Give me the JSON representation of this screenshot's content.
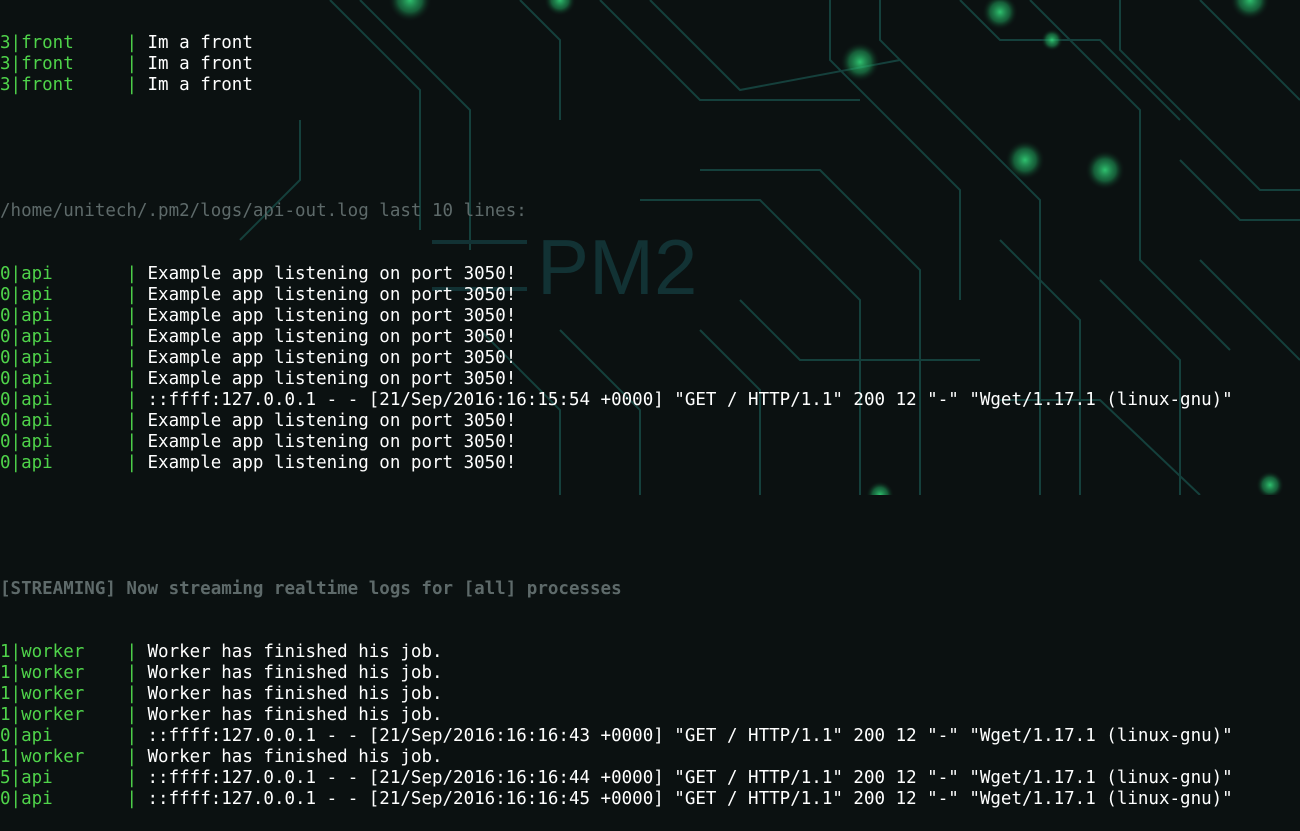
{
  "watermark": {
    "logo_text": "PM2"
  },
  "colors": {
    "background": "#0b1111",
    "prefix": "#4fd34a",
    "message": "#ffffff",
    "header": "#5e6a6a",
    "circuit_line": "#15403c",
    "circuit_node": "#2fd27a"
  },
  "log": {
    "top_lines": [
      {
        "prefix": "3|front",
        "message": "Im a front"
      },
      {
        "prefix": "3|front",
        "message": "Im a front"
      },
      {
        "prefix": "3|front",
        "message": "Im a front"
      }
    ],
    "api_header": "/home/unitech/.pm2/logs/api-out.log last 10 lines:",
    "api_lines": [
      {
        "prefix": "0|api",
        "message": "Example app listening on port 3050!"
      },
      {
        "prefix": "0|api",
        "message": "Example app listening on port 3050!"
      },
      {
        "prefix": "0|api",
        "message": "Example app listening on port 3050!"
      },
      {
        "prefix": "0|api",
        "message": "Example app listening on port 3050!"
      },
      {
        "prefix": "0|api",
        "message": "Example app listening on port 3050!"
      },
      {
        "prefix": "0|api",
        "message": "Example app listening on port 3050!"
      },
      {
        "prefix": "0|api",
        "message": "::ffff:127.0.0.1 - - [21/Sep/2016:16:15:54 +0000] \"GET / HTTP/1.1\" 200 12 \"-\" \"Wget/1.17.1 (linux-gnu)\""
      },
      {
        "prefix": "0|api",
        "message": "Example app listening on port 3050!"
      },
      {
        "prefix": "0|api",
        "message": "Example app listening on port 3050!"
      },
      {
        "prefix": "0|api",
        "message": "Example app listening on port 3050!"
      }
    ],
    "streaming_header": "[STREAMING] Now streaming realtime logs for [all] processes",
    "stream_lines": [
      {
        "prefix": "1|worker",
        "message": "Worker has finished his job."
      },
      {
        "prefix": "1|worker",
        "message": "Worker has finished his job."
      },
      {
        "prefix": "1|worker",
        "message": "Worker has finished his job."
      },
      {
        "prefix": "1|worker",
        "message": "Worker has finished his job."
      },
      {
        "prefix": "0|api",
        "message": "::ffff:127.0.0.1 - - [21/Sep/2016:16:16:43 +0000] \"GET / HTTP/1.1\" 200 12 \"-\" \"Wget/1.17.1 (linux-gnu)\""
      },
      {
        "prefix": "1|worker",
        "message": "Worker has finished his job."
      },
      {
        "prefix": "5|api",
        "message": "::ffff:127.0.0.1 - - [21/Sep/2016:16:16:44 +0000] \"GET / HTTP/1.1\" 200 12 \"-\" \"Wget/1.17.1 (linux-gnu)\""
      },
      {
        "prefix": "0|api",
        "message": "::ffff:127.0.0.1 - - [21/Sep/2016:16:16:45 +0000] \"GET / HTTP/1.1\" 200 12 \"-\" \"Wget/1.17.1 (linux-gnu)\""
      }
    ]
  }
}
